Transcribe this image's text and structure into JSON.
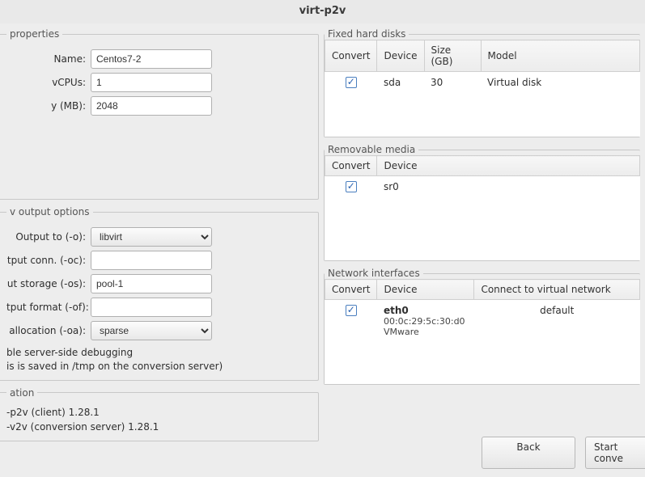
{
  "title": "virt-p2v",
  "properties": {
    "legend": "properties",
    "name_label": "Name:",
    "name_value": "Centos7-2",
    "vcpus_label": "vCPUs:",
    "vcpus_value": "1",
    "mem_label": "y (MB):",
    "mem_value": "2048"
  },
  "output": {
    "legend": "v output options",
    "output_to_label": "Output to (-o):",
    "output_to_value": "libvirt",
    "conn_label": "tput conn. (-oc):",
    "conn_value": "",
    "storage_label": "ut storage (-os):",
    "storage_value": "pool-1",
    "format_label": "tput format (-of):",
    "format_value": "",
    "alloc_label": "allocation (-oa):",
    "alloc_value": "sparse",
    "debug_line1": "ble server-side debugging",
    "debug_line2": "is is saved in /tmp on the conversion server)"
  },
  "information": {
    "legend": "ation",
    "line1": "-p2v (client) 1.28.1",
    "line2": "-v2v (conversion server) 1.28.1"
  },
  "fixed_disks": {
    "legend": "Fixed hard disks",
    "headers": {
      "convert": "Convert",
      "device": "Device",
      "size": "Size (GB)",
      "model": "Model"
    },
    "rows": [
      {
        "device": "sda",
        "size": "30",
        "model": "Virtual disk"
      }
    ]
  },
  "removable": {
    "legend": "Removable media",
    "headers": {
      "convert": "Convert",
      "device": "Device"
    },
    "rows": [
      {
        "device": "sr0"
      }
    ]
  },
  "network": {
    "legend": "Network interfaces",
    "headers": {
      "convert": "Convert",
      "device": "Device",
      "connect": "Connect to virtual network"
    },
    "rows": [
      {
        "device": "eth0",
        "mac": "00:0c:29:5c:30:d0",
        "vendor": "VMware",
        "connect": "default"
      }
    ]
  },
  "buttons": {
    "back": "Back",
    "start": "Start conve"
  }
}
